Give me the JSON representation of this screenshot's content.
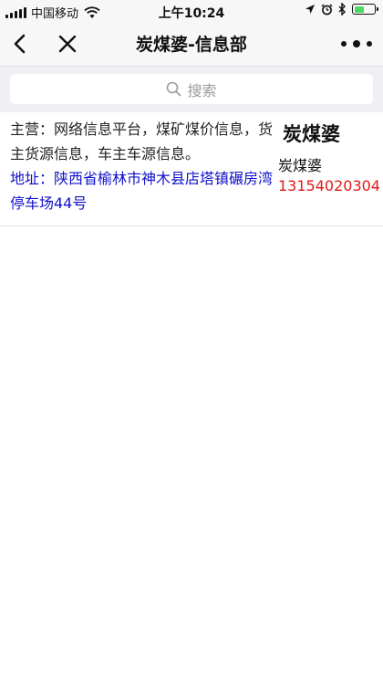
{
  "status_bar": {
    "carrier": "中国移动",
    "time": "上午10:24",
    "battery_level": 0.5
  },
  "nav": {
    "title": "炭煤婆-信息部"
  },
  "search": {
    "placeholder": "搜索"
  },
  "listing": {
    "description": "主营：网络信息平台，煤矿煤价信息，货主货源信息，车主车源信息。",
    "address": "地址：陕西省榆林市神木县店塔镇碾房湾停车场44号",
    "company": "炭煤婆",
    "contact": "炭煤婆",
    "phone": "13154020304"
  },
  "colors": {
    "address": "#1010cc",
    "phone": "#e21818",
    "battery": "#4cd964"
  }
}
